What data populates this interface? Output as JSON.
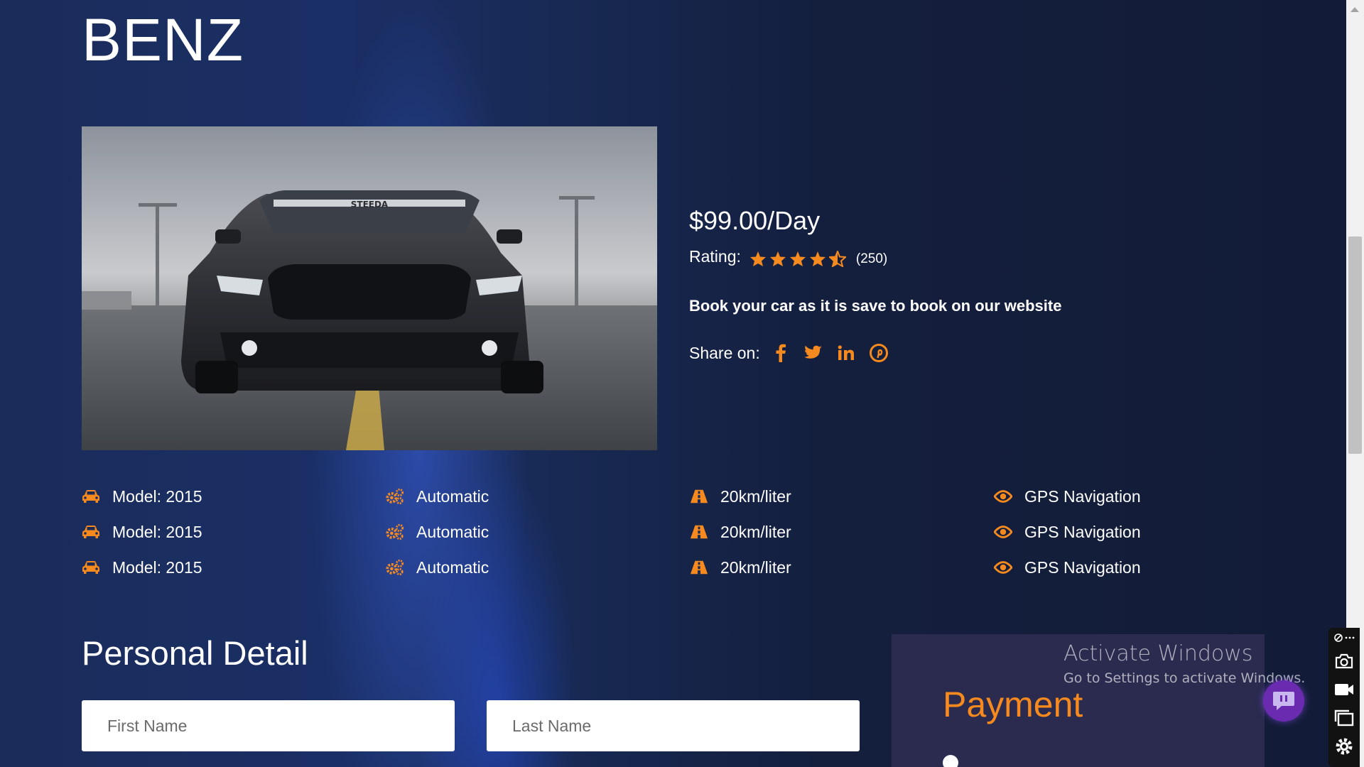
{
  "car": {
    "title": "BENZ",
    "plate_text": "STEEDA"
  },
  "pricing": {
    "price": "$99.00/Day",
    "rating_label": "Rating:",
    "rating_value": 4.5,
    "rating_count": "(250)",
    "tagline": "Book your car as it is save to book on our website",
    "share_label": "Share on:"
  },
  "share_icons": [
    "facebook-icon",
    "twitter-icon",
    "linkedin-icon",
    "pinterest-icon"
  ],
  "features": [
    [
      {
        "icon": "car-icon",
        "text": "Model: 2015"
      },
      {
        "icon": "gears-icon",
        "text": "Automatic"
      },
      {
        "icon": "road-icon",
        "text": "20km/liter"
      },
      {
        "icon": "eye-icon",
        "text": "GPS Navigation"
      }
    ],
    [
      {
        "icon": "car-icon",
        "text": "Model: 2015"
      },
      {
        "icon": "gears-icon",
        "text": "Automatic"
      },
      {
        "icon": "road-icon",
        "text": "20km/liter"
      },
      {
        "icon": "eye-icon",
        "text": "GPS Navigation"
      }
    ],
    [
      {
        "icon": "car-icon",
        "text": "Model: 2015"
      },
      {
        "icon": "gears-icon",
        "text": "Automatic"
      },
      {
        "icon": "road-icon",
        "text": "20km/liter"
      },
      {
        "icon": "eye-icon",
        "text": "GPS Navigation"
      }
    ]
  ],
  "personal": {
    "title": "Personal Detail",
    "first_name_placeholder": "First Name",
    "last_name_placeholder": "Last Name"
  },
  "payment": {
    "title": "Payment"
  },
  "windows_watermark": {
    "line1": "Activate Windows",
    "line2": "Go to Settings to activate Windows."
  },
  "colors": {
    "accent": "#f68a1e",
    "background": "#152347",
    "payment_card": "#2a2b4f"
  }
}
